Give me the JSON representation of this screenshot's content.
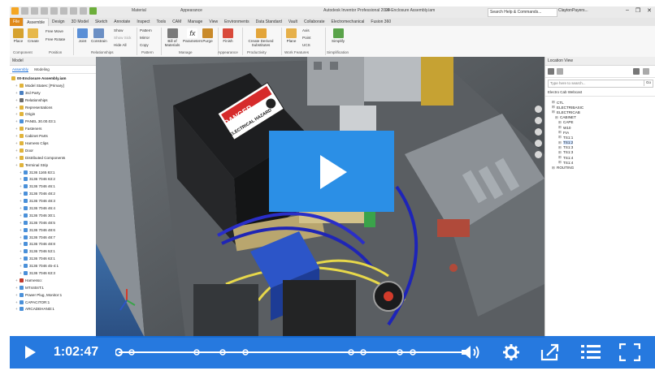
{
  "app": {
    "title": "Autodesk Inventor Professional 2024",
    "document": "00-Enclosure Assembly.iam",
    "material_field": "Material",
    "appearance_field": "Appearance",
    "search_placeholder": "Search Help & Commands...",
    "user": "ClaytonPayers..."
  },
  "ribbon_tabs": [
    "File",
    "Assemble",
    "Design",
    "3D Model",
    "Sketch",
    "Annotate",
    "Inspect",
    "Tools",
    "CAM",
    "Manage",
    "View",
    "Environments",
    "Data Standard",
    "Vault",
    "Collaborate",
    "Electromechanical",
    "Fusion 360"
  ],
  "active_tab": "Assemble",
  "ribbon": {
    "place": "Place",
    "create": "Create",
    "free_move": "Free Move",
    "free_rotate": "Free Rotate",
    "joint": "Joint",
    "constrain": "Constrain",
    "show": "Show",
    "show_sick": "Show Sick",
    "hide_all": "Hide All",
    "pattern": "Pattern",
    "mirror": "Mirror",
    "copy": "Copy",
    "bom": "Bill of Materials",
    "parameters": "Parameters",
    "purge": "Purge",
    "finish": "Finish",
    "create_derived": "Create Derived Substitutes",
    "plane": "Plane",
    "axis": "Axis",
    "point": "Point",
    "ucs": "UCS",
    "simplify": "Simplify",
    "groups": [
      "Component",
      "Position",
      "Relationships",
      "Pattern",
      "Manage",
      "Appearance",
      "Productivity",
      "Work Features",
      "Simplification"
    ]
  },
  "model_browser": {
    "title": "Model",
    "tabs": [
      "Assembly",
      "Modeling"
    ],
    "root": "00-Enclosure Assembly.iam",
    "items": [
      {
        "label": "Model States: [Primary]",
        "indent": 1,
        "color": "#e0b33a"
      },
      {
        "label": "3rd Party",
        "indent": 1,
        "color": "#4a7fc0"
      },
      {
        "label": "Relationships",
        "indent": 1,
        "color": "#6b6b6b"
      },
      {
        "label": "Representations",
        "indent": 1,
        "color": "#e0b33a"
      },
      {
        "label": "Origin",
        "indent": 1,
        "color": "#e0b33a"
      },
      {
        "label": "PANEL 30.00.03:1",
        "indent": 1,
        "color": "#4a90d9"
      },
      {
        "label": "Fasteners",
        "indent": 1,
        "color": "#e0b33a"
      },
      {
        "label": "Cabinet Parts",
        "indent": 1,
        "color": "#e0b33a"
      },
      {
        "label": "Harness Clips",
        "indent": 1,
        "color": "#e0b33a"
      },
      {
        "label": "Door",
        "indent": 1,
        "color": "#e0b33a"
      },
      {
        "label": "Distributed Components",
        "indent": 1,
        "color": "#e0b33a"
      },
      {
        "label": "Terminal Strip",
        "indent": 1,
        "color": "#e0b33a"
      },
      {
        "label": "3136 1165 83:1",
        "indent": 2,
        "color": "#4a90d9"
      },
      {
        "label": "3136 7046 63:2",
        "indent": 2,
        "color": "#4a90d9"
      },
      {
        "label": "3136 7046 46:1",
        "indent": 2,
        "color": "#4a90d9"
      },
      {
        "label": "3136 7046 48:2",
        "indent": 2,
        "color": "#4a90d9"
      },
      {
        "label": "3136 7046 48:3",
        "indent": 2,
        "color": "#4a90d9"
      },
      {
        "label": "3136 7046 46:4",
        "indent": 2,
        "color": "#4a90d9"
      },
      {
        "label": "3136 7046 30:1",
        "indent": 2,
        "color": "#4a90d9"
      },
      {
        "label": "3136 7046 48:5",
        "indent": 2,
        "color": "#4a90d9"
      },
      {
        "label": "3136 7046 48:6",
        "indent": 2,
        "color": "#4a90d9"
      },
      {
        "label": "3136 7046 48:7",
        "indent": 2,
        "color": "#4a90d9"
      },
      {
        "label": "3136 7046 48:8",
        "indent": 2,
        "color": "#4a90d9"
      },
      {
        "label": "3136 7046 53:1",
        "indent": 2,
        "color": "#4a90d9"
      },
      {
        "label": "3136 7046 63:1",
        "indent": 2,
        "color": "#4a90d9"
      },
      {
        "label": "3136 7046 45-4:1",
        "indent": 2,
        "color": "#4a90d9"
      },
      {
        "label": "3136 7046 63:3",
        "indent": 2,
        "color": "#4a90d9"
      },
      {
        "label": "Harnesso:",
        "indent": 1,
        "color": "#c0392b"
      },
      {
        "label": "MT4404T:1",
        "indent": 1,
        "color": "#4a90d9"
      },
      {
        "label": "Power Plug, Monitor:1",
        "indent": 1,
        "color": "#4a90d9"
      },
      {
        "label": "CAPACITOR:1",
        "indent": 1,
        "color": "#4a90d9"
      },
      {
        "label": "ARCADEHAND:1",
        "indent": 1,
        "color": "#4a90d9"
      }
    ]
  },
  "location_view": {
    "title": "Location View",
    "search_placeholder": "Type here to search...",
    "go": "Go",
    "path": "Electro Cab Webcast",
    "items": [
      {
        "label": "CTL",
        "indent": 1
      },
      {
        "label": "ELECTRIBASIC",
        "indent": 1
      },
      {
        "label": "ELECTRICAB",
        "indent": 1
      },
      {
        "label": "CABINET",
        "indent": 2
      },
      {
        "label": "CAPE",
        "indent": 3
      },
      {
        "label": "W10",
        "indent": 3
      },
      {
        "label": "FIA",
        "indent": 3
      },
      {
        "label": "TS1:1",
        "indent": 3
      },
      {
        "label": "TS1:2",
        "indent": 3,
        "selected": true
      },
      {
        "label": "TS1:3",
        "indent": 3
      },
      {
        "label": "TS1:3",
        "indent": 3
      },
      {
        "label": "TS1:4",
        "indent": 3
      },
      {
        "label": "TS1:4",
        "indent": 3
      },
      {
        "label": "ROUTING",
        "indent": 1
      }
    ]
  },
  "viewport": {
    "danger_sign": "DANGER",
    "hazard_text": "ELECTRICAL HAZARD"
  },
  "video": {
    "elapsed": "1:02:47",
    "progress": 0.0,
    "play_label": "Play"
  }
}
